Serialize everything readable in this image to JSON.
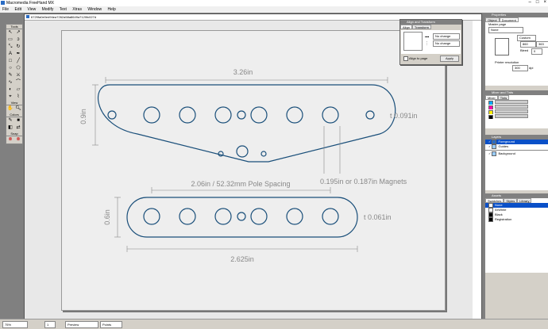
{
  "app": {
    "title": "Macromedia FreeHand MX"
  },
  "menu": [
    "File",
    "Edit",
    "View",
    "Modify",
    "Text",
    "Xtras",
    "Window",
    "Help"
  ],
  "tools": {
    "tools_label": "Tools",
    "colors_label": "Colors",
    "view_label": "View",
    "snap_label": "Snap"
  },
  "document": {
    "title": "6729fa0e0ed94ea7262a58a8649a7120fc027d"
  },
  "drawing": {
    "top_width": "3.26in",
    "left_height_top": "0.9in",
    "thickness_top": "t 0.091in",
    "magnets": "0.195in or 0.187in Magnets",
    "spacing": "2.06in / 52.32mm Pole Spacing",
    "left_height_bottom": "0.6in",
    "thickness_bottom": "t 0.061in",
    "bottom_width": "2.625in"
  },
  "align_panel": {
    "title": "Align and Transform",
    "tabs": [
      "Align",
      "Transform"
    ],
    "horizontal": "No change",
    "vertical": "No change",
    "align_to_page": "Align to page",
    "apply": "Apply"
  },
  "properties": {
    "title": "Properties",
    "tabs": [
      "Object",
      "Document"
    ],
    "master_page_label": "Master page",
    "master_page_value": "None",
    "size_value": "Custom",
    "x_value": "860",
    "y_value": "363",
    "bleed_label": "Bleed",
    "bleed_value": "0",
    "printer_resolution_label": "Printer resolution",
    "printer_resolution_value": "300",
    "dpi": "dpi"
  },
  "mixer": {
    "title": "Mixer and Tints",
    "tabs": [
      "Mixer",
      "Tints"
    ]
  },
  "layers": {
    "title": "Layers",
    "items": [
      {
        "name": "Foreground",
        "selected": true
      },
      {
        "name": "Guides",
        "selected": false
      },
      {
        "name": "Background",
        "selected": false
      }
    ]
  },
  "swatches": {
    "title": "Assets",
    "tabs": [
      "Swatches",
      "Styles",
      "Library"
    ],
    "items": [
      {
        "name": "None",
        "color": "#ffffff",
        "selected": true
      },
      {
        "name": "0xWhite",
        "color": "#ffffff",
        "selected": false
      },
      {
        "name": "Black",
        "color": "#000000",
        "selected": false
      },
      {
        "name": "Registration",
        "color": "#000000",
        "selected": false
      }
    ]
  },
  "status": {
    "zoom": "75%",
    "page": "1",
    "mode": "Preview",
    "units": "Points"
  },
  "colors": {
    "stroke": "#1a4f7a",
    "dim": "#888888"
  }
}
